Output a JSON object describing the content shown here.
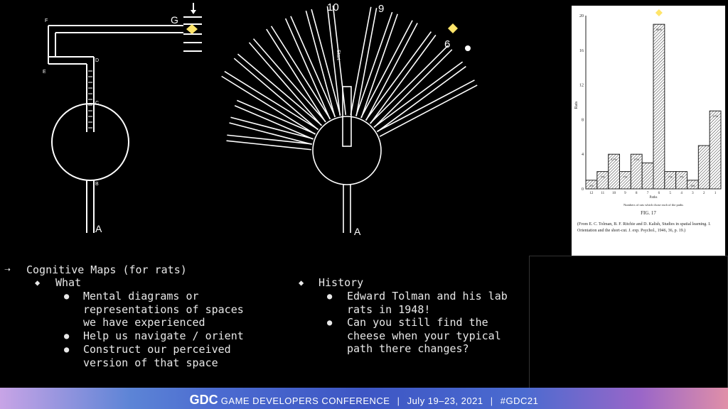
{
  "diagram_left": {
    "label_g": "G",
    "label_a": "A",
    "letters": [
      "F",
      "E",
      "D",
      "C",
      "B"
    ]
  },
  "diagram_center": {
    "path_numbers": [
      "10",
      "9",
      "6",
      "A"
    ],
    "start_label": "Start"
  },
  "figure": {
    "y_ticks": [
      "20",
      "16",
      "12",
      "8",
      "4",
      "0"
    ],
    "y_label": "Rats",
    "x_label": "Paths",
    "axis_caption": "Numbers of rats which chose each of the paths",
    "fig_label": "FIG. 17",
    "citation": "(From E. C. Tolman, B. F. Ritchie and D. Kalish, Studies in spatial learning. I. Orientation and the short-cut. J. exp. Psychol., 1946, 36, p. 19.)"
  },
  "chart_data": {
    "type": "bar",
    "categories": [
      "12",
      "11",
      "10",
      "9",
      "8",
      "7",
      "6",
      "5",
      "4",
      "3",
      "2",
      "1"
    ],
    "values": [
      1,
      2,
      4,
      2,
      4,
      3,
      19,
      2,
      2,
      1,
      5,
      9
    ],
    "data_labels": [
      "4%",
      "7%",
      "17%",
      "7%",
      "17%",
      "",
      "36%",
      "7%",
      "7%",
      "4%",
      "",
      "17%"
    ],
    "ylabel": "Rats",
    "xlabel": "Paths",
    "ylim": [
      0,
      20
    ],
    "highlight_category": "6",
    "highlight_color": "#ffe56a"
  },
  "notes": {
    "arrow": "➝",
    "heading": "Cognitive Maps (for rats)",
    "what": "What",
    "what_items": [
      "Mental diagrams or\nrepresentations of spaces\nwe have experienced",
      "Help us navigate / orient",
      "Construct our perceived\nversion of that space"
    ],
    "history": "History",
    "history_items": [
      "Edward Tolman and his lab\nrats in 1948!",
      "Can you still find the\ncheese when your typical\npath there changes?"
    ]
  },
  "banner": {
    "logo": "GDC",
    "conference": "GAME DEVELOPERS CONFERENCE",
    "sep": "|",
    "dates": "July 19–23, 2021",
    "hashtag": "#GDC21"
  },
  "colors": {
    "highlight": "#ffe56a",
    "background": "#000000",
    "banner_blue": "#4b6bd0"
  }
}
